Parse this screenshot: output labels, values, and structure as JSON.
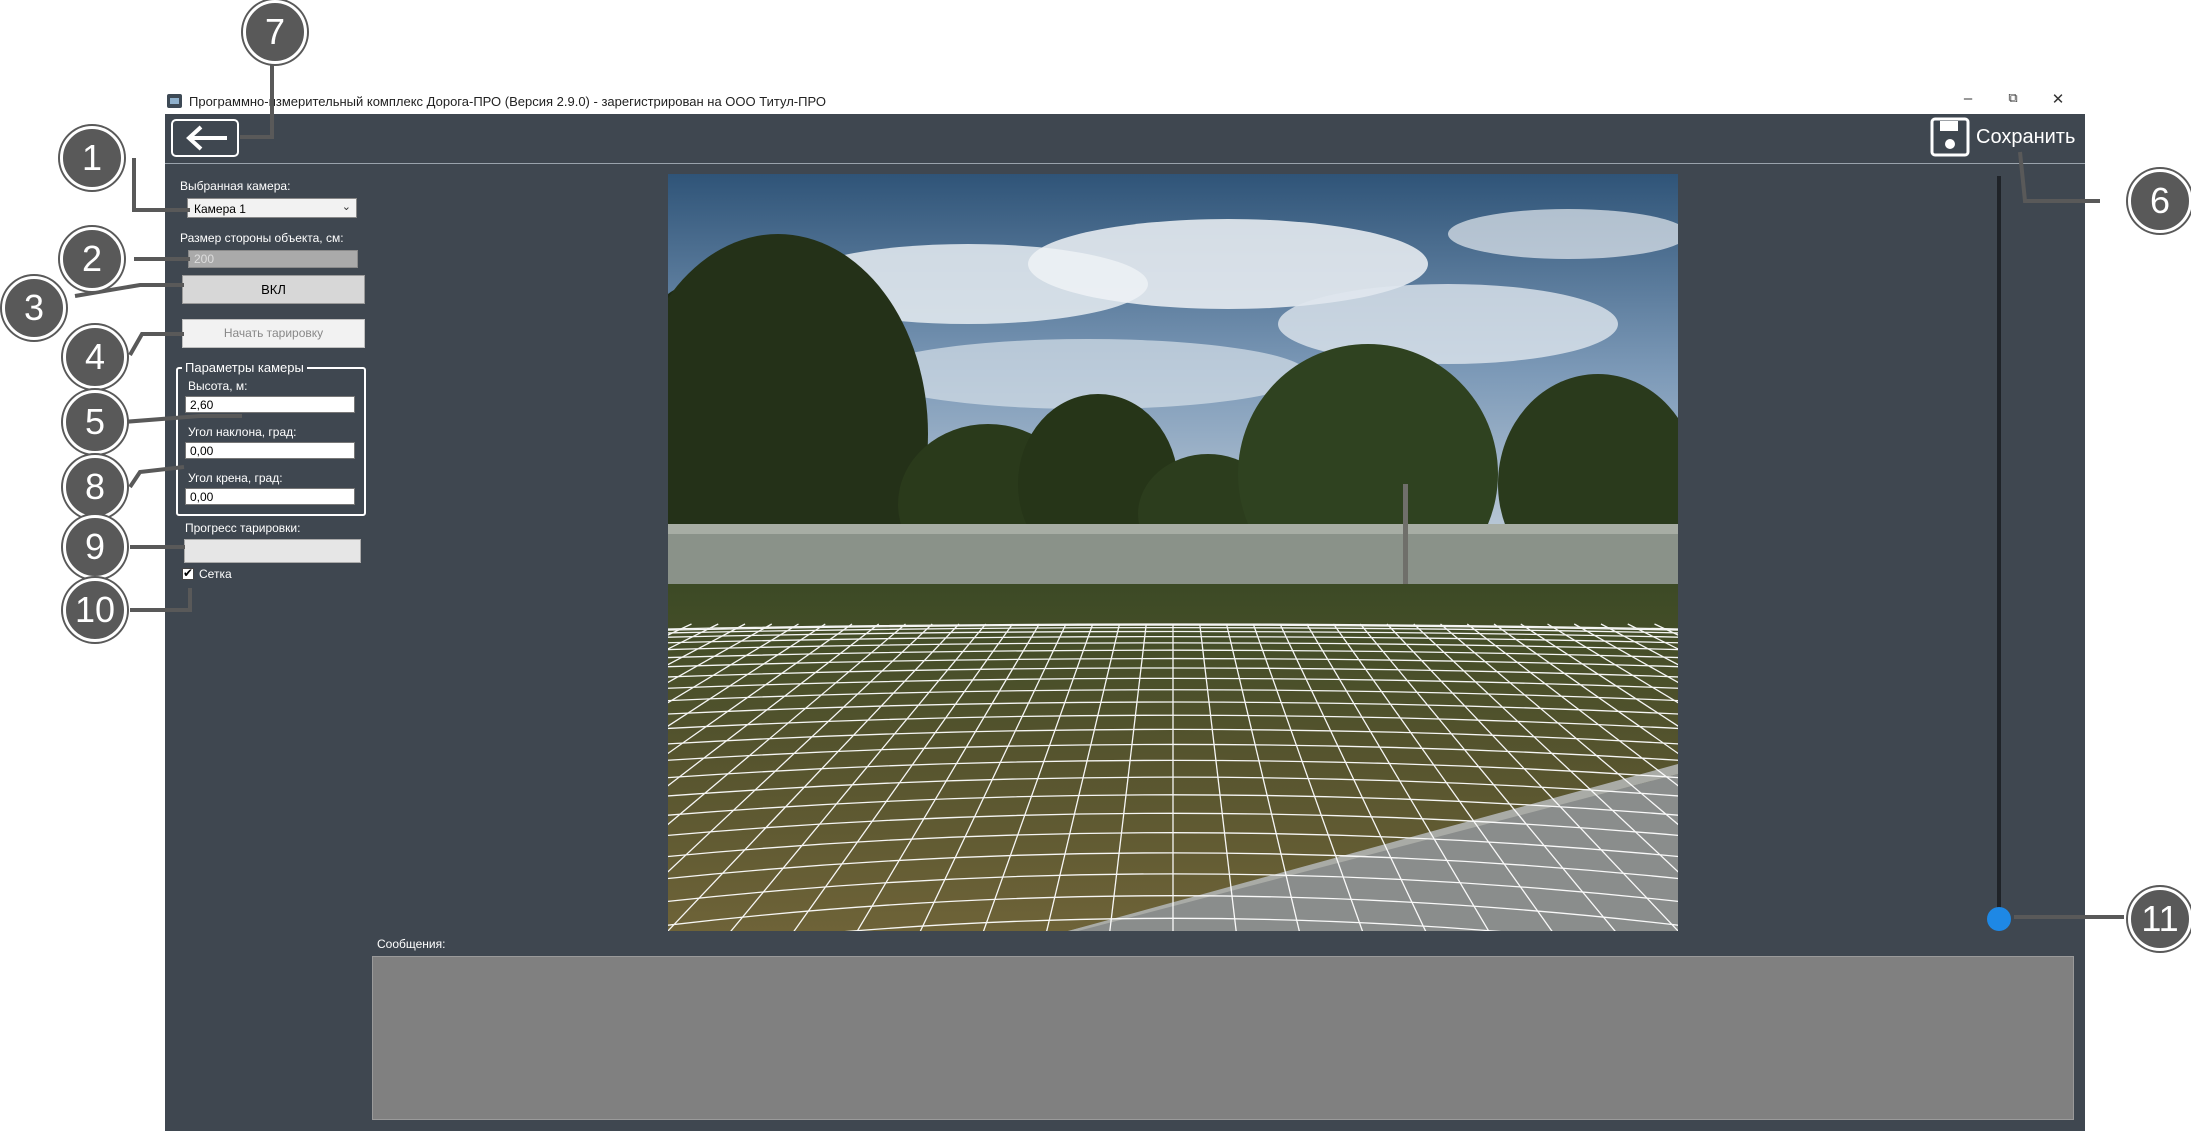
{
  "window": {
    "title": "Программно-измерительный комплекс Дорога-ПРО (Версия 2.9.0) - зарегистрирован на ООО Титул-ПРО",
    "minimize": "–",
    "restore": "⧉",
    "close": "✕"
  },
  "toolbar": {
    "back_icon": "arrow-left-icon",
    "save_label": "Сохранить",
    "save_icon": "floppy-disk-icon"
  },
  "sidebar": {
    "camera_label": "Выбранная камера:",
    "camera_value": "Камера 1",
    "object_size_label": "Размер стороны объекта, см:",
    "object_size_value": "200",
    "on_button": "ВКЛ",
    "start_button": "Начать тарировку",
    "camera_params": {
      "title": "Параметры камеры",
      "height_label": "Высота, м:",
      "height_value": "2,60",
      "tilt_label": "Угол наклона, град:",
      "tilt_value": "0,00",
      "roll_label": "Угол крена, град:",
      "roll_value": "0,00"
    },
    "progress_label": "Прогресс тарировки:",
    "progress_value": 0,
    "grid_label": "Сетка",
    "grid_checked": true
  },
  "slider": {
    "value": 0
  },
  "messages": {
    "label": "Сообщения:"
  },
  "callouts": [
    "1",
    "2",
    "3",
    "4",
    "5",
    "6",
    "7",
    "8",
    "9",
    "10",
    "11"
  ],
  "colors": {
    "window_bg": "#3f4750",
    "slider_thumb": "#1e88e5",
    "callout_bg": "#595959"
  }
}
